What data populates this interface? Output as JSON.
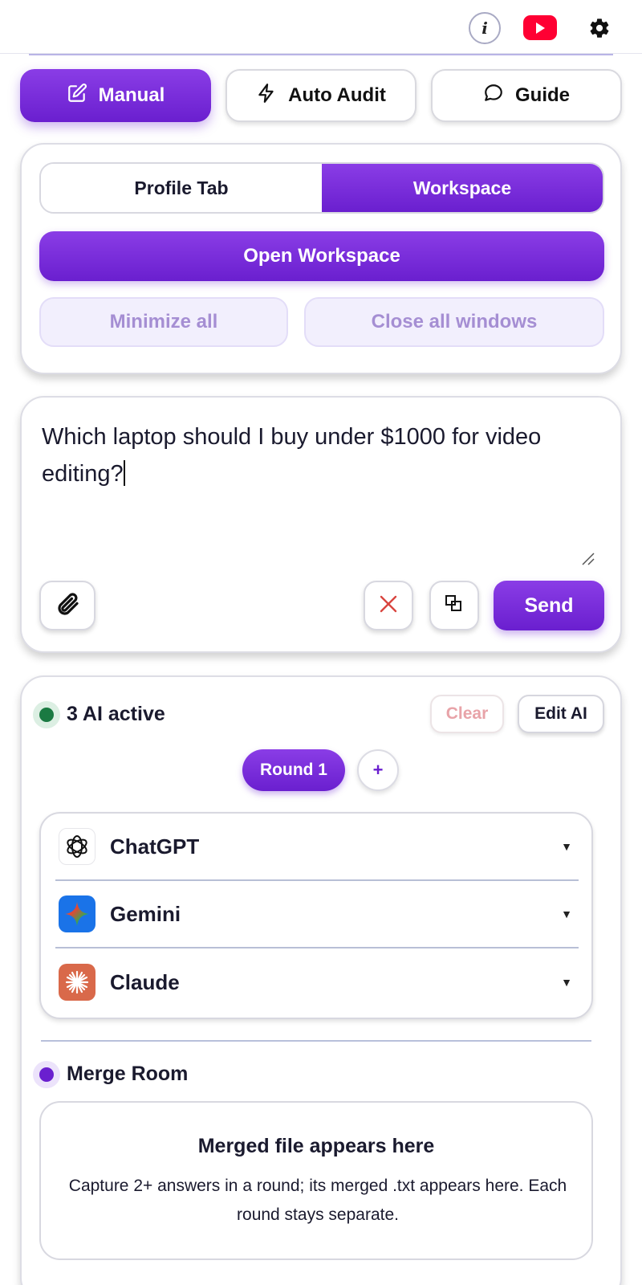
{
  "header": {
    "info_label": "i",
    "youtube_icon": "youtube-icon",
    "settings_icon": "gear-icon"
  },
  "modes": [
    {
      "label": "Manual",
      "icon": "edit-icon",
      "active": true
    },
    {
      "label": "Auto Audit",
      "icon": "lightning-icon",
      "active": false
    },
    {
      "label": "Guide",
      "icon": "chat-bubble-icon",
      "active": false
    }
  ],
  "workspace_card": {
    "tabs": [
      {
        "label": "Profile Tab",
        "active": false
      },
      {
        "label": "Workspace",
        "active": true
      }
    ],
    "open_workspace": "Open Workspace",
    "minimize_all": "Minimize all",
    "close_all": "Close all windows"
  },
  "prompt": {
    "text": "Which laptop should I buy under $1000 for video editing?",
    "send_label": "Send"
  },
  "ai_panel": {
    "status": "3 AI active",
    "clear_label": "Clear",
    "edit_label": "Edit AI",
    "round_label": "Round 1",
    "add_round": "+",
    "caret": "▼",
    "models": [
      {
        "name": "ChatGPT"
      },
      {
        "name": "Gemini"
      },
      {
        "name": "Claude"
      }
    ]
  },
  "merge": {
    "label": "Merge Room",
    "title": "Merged file appears here",
    "description": "Capture 2+ answers in a round; its merged .txt appears here. Each round stays separate."
  },
  "colors": {
    "accent": "#6a1fcf",
    "accent_light": "#8a3de6",
    "status_green": "#1a7a42",
    "youtube_red": "#ff0033"
  }
}
